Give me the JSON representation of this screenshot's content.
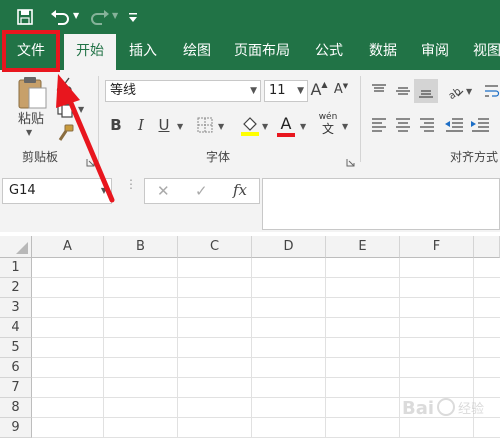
{
  "quick_access": {
    "save_icon": "save-icon",
    "undo_icon": "undo-icon",
    "redo_icon": "redo-icon",
    "customize_icon": "customize-qat-icon"
  },
  "tabs": [
    "文件",
    "开始",
    "插入",
    "绘图",
    "页面布局",
    "公式",
    "数据",
    "审阅",
    "视图"
  ],
  "ribbon": {
    "clipboard": {
      "paste_label": "粘贴",
      "group_label": "剪贴板"
    },
    "font": {
      "font_name": "等线",
      "font_size": "11",
      "group_label": "字体",
      "grow_label": "A",
      "shrink_label": "A",
      "bold_label": "B",
      "italic_label": "I",
      "underline_label": "U",
      "font_color_label": "A",
      "phonetic_top": "wén",
      "phonetic_bottom": "文"
    },
    "alignment": {
      "group_label": "对齐方式"
    }
  },
  "formula_bar": {
    "name_box": "G14",
    "cancel_icon": "✕",
    "enter_icon": "✓",
    "fx_label": "fx",
    "value": ""
  },
  "sheet": {
    "columns": [
      "A",
      "B",
      "C",
      "D",
      "E",
      "F"
    ],
    "rows": [
      "1",
      "2",
      "3",
      "4",
      "5",
      "6",
      "7",
      "8",
      "9"
    ]
  },
  "annotation": {
    "highlight_color": "#e8161e"
  },
  "colors": {
    "brand": "#217346"
  }
}
